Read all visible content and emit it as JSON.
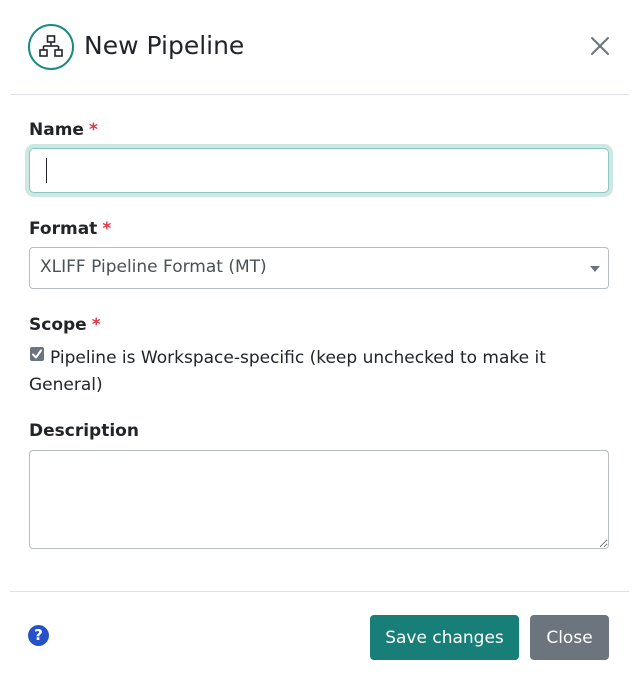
{
  "dialog": {
    "title": "New Pipeline",
    "icon": "network-icon",
    "accent": "#177f78"
  },
  "form": {
    "name": {
      "label": "Name",
      "required_marker": "*",
      "value": ""
    },
    "format": {
      "label": "Format",
      "required_marker": "*",
      "selected": "XLIFF Pipeline Format (MT)"
    },
    "scope": {
      "label": "Scope",
      "required_marker": "*",
      "checked": true,
      "checkbox_text": "Pipeline is Workspace-specific (keep unchecked to make it General)"
    },
    "description": {
      "label": "Description",
      "value": ""
    }
  },
  "footer": {
    "help_symbol": "?",
    "save_label": "Save changes",
    "close_label": "Close"
  },
  "colors": {
    "save_button": "#177f78",
    "close_button": "#6c757d",
    "required": "#dc3545",
    "help": "#2553c7"
  }
}
